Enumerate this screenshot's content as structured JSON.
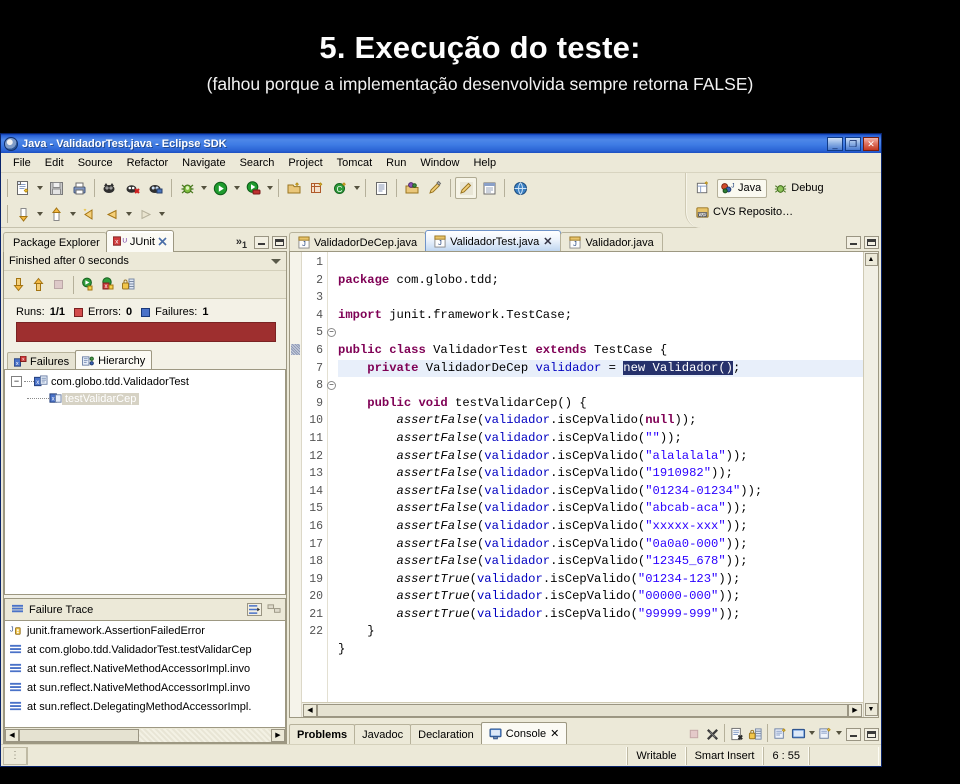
{
  "slide": {
    "title": "5. Execução do teste:",
    "subtitle": "(falhou porque a implementação desenvolvida sempre retorna FALSE)"
  },
  "window": {
    "title": "Java - ValidadorTest.java - Eclipse SDK",
    "buttons": {
      "minimize": "_",
      "restore": "❐",
      "close": "✕"
    }
  },
  "menubar": {
    "items": [
      "File",
      "Edit",
      "Source",
      "Refactor",
      "Navigate",
      "Search",
      "Project",
      "Tomcat",
      "Run",
      "Window",
      "Help"
    ]
  },
  "toolbar": {
    "row1_icons": [
      "new-wizard-icon",
      "dropdown-arrow",
      "save-icon",
      "print-icon",
      "separator",
      "open-type-icon",
      "search-remove-icon",
      "search-icon",
      "separator",
      "debug-icon",
      "dropdown-arrow",
      "run-icon",
      "dropdown-arrow",
      "run-last-icon",
      "dropdown-arrow",
      "separator",
      "new-java-project-icon",
      "new-package-icon",
      "new-class-icon",
      "dropdown-arrow",
      "separator",
      "open-task-icon",
      "separator",
      "externaltools-icon",
      "annotation-icon",
      "separator",
      "toggle-markoccurrences-icon",
      "show-whitespace-icon",
      "separator",
      "open-browser-icon"
    ],
    "row2_icons": [
      "next-annotation-icon",
      "dropdown-arrow",
      "previous-annotation-icon",
      "dropdown-arrow",
      "last-edit-location-icon",
      "back-icon",
      "dropdown-arrow",
      "forward-icon",
      "dropdown-arrow"
    ]
  },
  "perspectives": {
    "open_perspective_label": "open-perspective-icon",
    "items": [
      {
        "label": "Java",
        "icon": "java-perspective-icon",
        "active": true
      },
      {
        "label": "Debug",
        "icon": "debug-perspective-icon",
        "active": false
      },
      {
        "label": "CVS Reposito…",
        "icon": "cvs-perspective-icon",
        "active": false
      }
    ]
  },
  "left_panel": {
    "tabs": [
      {
        "label": "Package Explorer",
        "icon": "package-explorer-icon",
        "active": false
      },
      {
        "label": "JUnit",
        "icon": "junit-icon",
        "active": true
      }
    ],
    "overflow_chevron": "»",
    "overflow_count": "1",
    "junit": {
      "status": "Finished after 0 seconds",
      "toolbar_icons": [
        "next-failure-icon",
        "previous-failure-icon",
        "stop-icon",
        "separator",
        "rerun-test-icon",
        "rerun-failures-icon",
        "lock-scroll-icon"
      ],
      "counters": [
        {
          "label": "Runs:",
          "value": "1/1",
          "icon": ""
        },
        {
          "label": "Errors:",
          "value": "0",
          "icon": "error-icon"
        },
        {
          "label": "Failures:",
          "value": "1",
          "icon": "failure-icon"
        }
      ],
      "progress_color": "#9e2f2f",
      "sub_tabs": [
        {
          "label": "Failures",
          "icon": "failures-icon",
          "active": false
        },
        {
          "label": "Hierarchy",
          "icon": "hierarchy-icon",
          "active": true
        }
      ],
      "tree": [
        {
          "label": "com.globo.tdd.ValidadorTest",
          "level": 0,
          "expander": "−",
          "selected": false
        },
        {
          "label": "testValidarCep",
          "level": 1,
          "expander": "",
          "selected": true
        }
      ]
    },
    "failure_trace": {
      "title": "Failure Trace",
      "buttons": [
        "filter-stacktrace-icon",
        "compare-results-icon"
      ],
      "rows": [
        {
          "text": "junit.framework.AssertionFailedError",
          "icon": "exception-icon"
        },
        {
          "text": "at com.globo.tdd.ValidadorTest.testValidarCep",
          "icon": "stackframe-icon"
        },
        {
          "text": "at sun.reflect.NativeMethodAccessorImpl.invo",
          "icon": "stackframe-icon"
        },
        {
          "text": "at sun.reflect.NativeMethodAccessorImpl.invo",
          "icon": "stackframe-icon"
        },
        {
          "text": "at sun.reflect.DelegatingMethodAccessorImpl.",
          "icon": "stackframe-icon"
        }
      ]
    }
  },
  "editor": {
    "tabs": [
      {
        "label": "ValidadorDeCep.java",
        "icon": "java-file-icon",
        "active": false,
        "closable": false
      },
      {
        "label": "ValidadorTest.java",
        "icon": "java-file-icon",
        "active": true,
        "closable": true
      },
      {
        "label": "Validador.java",
        "icon": "java-file-icon",
        "active": false,
        "closable": false
      }
    ],
    "line_numbers": [
      "1",
      "2",
      "3",
      "4",
      "5",
      "6",
      "7",
      "8",
      "9",
      "10",
      "11",
      "12",
      "13",
      "14",
      "15",
      "16",
      "17",
      "18",
      "19",
      "20",
      "21",
      "22"
    ],
    "folding_markers": {
      "5": "−",
      "8": "−"
    },
    "current_line": 6,
    "code_lines": [
      "package com.globo.tdd;",
      "",
      "import junit.framework.TestCase;",
      "",
      "public class ValidadorTest extends TestCase {",
      "    private ValidadorDeCep validador = new Validador();",
      "",
      "    public void testValidarCep() {",
      "        assertFalse(validador.isCepValido(null));",
      "        assertFalse(validador.isCepValido(\"\"));",
      "        assertFalse(validador.isCepValido(\"alalalala\"));",
      "        assertFalse(validador.isCepValido(\"1910982\"));",
      "        assertFalse(validador.isCepValido(\"01234-01234\"));",
      "        assertFalse(validador.isCepValido(\"abcab-aca\"));",
      "        assertFalse(validador.isCepValido(\"xxxxx-xxx\"));",
      "        assertFalse(validador.isCepValido(\"0a0a0-000\"));",
      "        assertFalse(validador.isCepValido(\"12345_678\"));",
      "        assertTrue(validador.isCepValido(\"01234-123\"));",
      "        assertTrue(validador.isCepValido(\"00000-000\"));",
      "        assertTrue(validador.isCepValido(\"99999-999\"));",
      "    }",
      "}"
    ],
    "selection_text": "new Validador()"
  },
  "bottom_panel": {
    "tabs": [
      {
        "label": "Problems",
        "icon": "",
        "active": false
      },
      {
        "label": "Javadoc",
        "icon": "",
        "active": false
      },
      {
        "label": "Declaration",
        "icon": "",
        "active": false
      },
      {
        "label": "Console",
        "icon": "console-icon",
        "active": true
      }
    ],
    "toolbar_icons": [
      "terminate-icon",
      "remove-all-terminated-icon",
      "separator",
      "clear-console-icon",
      "scroll-lock-icon",
      "separator",
      "pin-console-icon",
      "display-console-icon",
      "dropdown-arrow",
      "open-console-icon",
      "dropdown-arrow",
      "minimize-icon",
      "maximize-icon"
    ]
  },
  "statusbar": {
    "writable": "Writable",
    "insert_mode": "Smart Insert",
    "position": "6 : 55"
  },
  "colors": {
    "title_bar": "#2b62d6",
    "chrome": "#ece9d8",
    "failure_red": "#9e2f2f",
    "keyword": "#7f0055",
    "string": "#2a00ff",
    "field": "#0000c0",
    "selection": "#26316b",
    "current_line": "#e8effa"
  }
}
